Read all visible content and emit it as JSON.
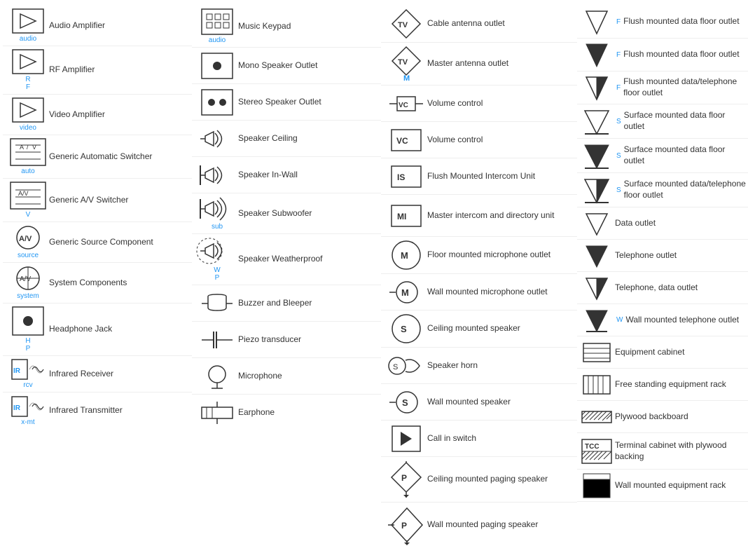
{
  "col1": [
    {
      "id": "audio-amp",
      "label": "audio",
      "name": "Audio Amplifier"
    },
    {
      "id": "rf-amp",
      "label": "R\nF",
      "name": "RF Amplifier"
    },
    {
      "id": "video-amp",
      "label": "video",
      "name": "Video Amplifier"
    },
    {
      "id": "auto-switcher",
      "label": "auto",
      "name": "Generic Automatic Switcher"
    },
    {
      "id": "av-switcher",
      "label": "V",
      "name": "Generic A/V Switcher"
    },
    {
      "id": "source",
      "label": "source",
      "name": "Generic Source Component"
    },
    {
      "id": "system",
      "label": "system",
      "name": "System Components"
    },
    {
      "id": "headphone",
      "label": "H\nP",
      "name": "Headphone Jack"
    },
    {
      "id": "ir-rcv",
      "label": "rcv",
      "name": "Infrared Receiver"
    },
    {
      "id": "ir-xmt",
      "label": "x-mt",
      "name": "Infrared Transmitter"
    }
  ],
  "col2": [
    {
      "id": "music-keypad",
      "label": "audio",
      "name": "Music Keypad"
    },
    {
      "id": "mono-speaker",
      "label": "",
      "name": "Mono Speaker Outlet"
    },
    {
      "id": "stereo-speaker",
      "label": "",
      "name": "Stereo Speaker Outlet"
    },
    {
      "id": "speaker-ceiling",
      "label": "",
      "name": "Speaker Ceiling"
    },
    {
      "id": "speaker-wall",
      "label": "",
      "name": "Speaker In-Wall"
    },
    {
      "id": "speaker-sub",
      "label": "sub",
      "name": "Speaker Subwoofer"
    },
    {
      "id": "speaker-wp",
      "label": "W\nP",
      "name": "Speaker Weatherproof"
    },
    {
      "id": "buzzer",
      "label": "",
      "name": "Buzzer and Bleeper"
    },
    {
      "id": "piezo",
      "label": "",
      "name": "Piezo transducer"
    },
    {
      "id": "microphone",
      "label": "",
      "name": "Microphone"
    },
    {
      "id": "earphone",
      "label": "",
      "name": "Earphone"
    }
  ],
  "col3": [
    {
      "id": "cable-ant",
      "label": "TV",
      "name": "Cable antenna outlet"
    },
    {
      "id": "master-ant",
      "label": "TV\nM",
      "name": "Master antenna outlet"
    },
    {
      "id": "vol-ctrl1",
      "label": "VC",
      "name": "Volume control"
    },
    {
      "id": "vol-ctrl2",
      "label": "VC",
      "name": "Volume control"
    },
    {
      "id": "flush-intercom",
      "label": "IS",
      "name": "Flush Mounted Intercom Unit"
    },
    {
      "id": "master-intercom",
      "label": "MI",
      "name": "Master intercom and directory unit"
    },
    {
      "id": "floor-mic",
      "label": "M",
      "name": "Floor mounted microphone outlet"
    },
    {
      "id": "wall-mic",
      "label": "M",
      "name": "Wall mounted microphone outlet"
    },
    {
      "id": "ceiling-spk",
      "label": "S",
      "name": "Ceiling mounted speaker"
    },
    {
      "id": "horn",
      "label": "S",
      "name": "Speaker horn"
    },
    {
      "id": "wall-spk",
      "label": "S",
      "name": "Wall mounted speaker"
    },
    {
      "id": "call-switch",
      "label": "",
      "name": "Call in switch"
    },
    {
      "id": "ceil-paging",
      "label": "P",
      "name": "Ceiling mounted paging speaker"
    },
    {
      "id": "wall-paging",
      "label": "P",
      "name": "Wall mounted paging speaker"
    }
  ],
  "col4": [
    {
      "id": "flush-data",
      "label": "F",
      "name": "Flush mounted data floor outlet"
    },
    {
      "id": "flush-data2",
      "label": "F",
      "name": "Flush mounted data floor outlet"
    },
    {
      "id": "flush-dataphone",
      "label": "F",
      "name": "Flush mounted data/telephone floor outlet"
    },
    {
      "id": "surface-data",
      "label": "S",
      "name": "Surface mounted data floor outlet"
    },
    {
      "id": "surface-data2",
      "label": "S",
      "name": "Surface mounted data floor outlet"
    },
    {
      "id": "surface-dataphone",
      "label": "S",
      "name": "Surface mounted data/telephone floor outlet"
    },
    {
      "id": "data-outlet",
      "label": "",
      "name": "Data outlet"
    },
    {
      "id": "tel-outlet",
      "label": "",
      "name": "Telephone outlet"
    },
    {
      "id": "tel-data",
      "label": "",
      "name": "Telephone, data outlet"
    },
    {
      "id": "wall-tel",
      "label": "W",
      "name": "Wall mounted telephone outlet"
    },
    {
      "id": "equip-cab",
      "label": "",
      "name": "Equipment cabinet"
    },
    {
      "id": "free-rack",
      "label": "",
      "name": "Free standing equipment rack"
    },
    {
      "id": "plywood",
      "label": "",
      "name": "Plywood backboard"
    },
    {
      "id": "tcc",
      "label": "TCC",
      "name": "Terminal cabinet with plywood backing"
    },
    {
      "id": "wall-rack",
      "label": "",
      "name": "Wall mounted equipment rack"
    }
  ]
}
